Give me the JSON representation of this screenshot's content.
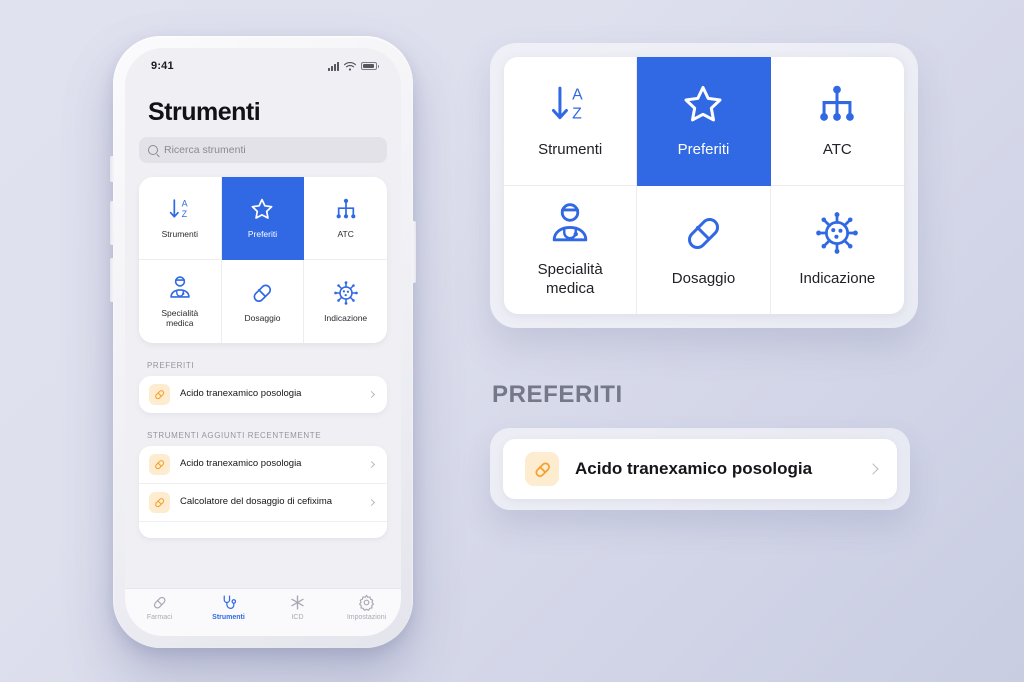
{
  "background": {
    "from": "#e0e2f0",
    "to": "#c9cde2"
  },
  "accent": {
    "blue": "#3069e3",
    "orange": "#f5a02a",
    "orange_bg": "#fdeccf",
    "label_gray": "#757888"
  },
  "phone": {
    "status": {
      "time": "9:41",
      "signal_icon": "cellular-signal-icon",
      "wifi_icon": "wifi-icon",
      "battery_icon": "battery-icon"
    },
    "title": "Strumenti",
    "search": {
      "placeholder": "Ricerca strumenti",
      "value": "",
      "icon": "search-icon"
    },
    "grid": [
      {
        "label": "Strumenti",
        "icon": "sort-alpha-down-icon",
        "selected": false
      },
      {
        "label": "Preferiti",
        "icon": "star-icon",
        "selected": true
      },
      {
        "label": "ATC",
        "icon": "hierarchy-tree-icon",
        "selected": false
      },
      {
        "label": "Specialità\nmedica",
        "icon": "doctor-icon",
        "selected": false
      },
      {
        "label": "Dosaggio",
        "icon": "pill-capsule-icon",
        "selected": false
      },
      {
        "label": "Indicazione",
        "icon": "virus-icon",
        "selected": false
      }
    ],
    "sections": [
      {
        "heading": "PREFERITI",
        "items": [
          {
            "label": "Acido tranexamico posologia",
            "icon": "pill-capsule-icon",
            "chevron": "chevron-right-icon"
          }
        ]
      },
      {
        "heading": "STRUMENTI AGGIUNTI RECENTEMENTE",
        "items": [
          {
            "label": "Acido tranexamico posologia",
            "icon": "pill-capsule-icon",
            "chevron": "chevron-right-icon"
          },
          {
            "label": "Calcolatore del dosaggio di cefixima",
            "icon": "pill-capsule-icon",
            "chevron": "chevron-right-icon"
          },
          {
            "label": "",
            "icon": "pill-capsule-icon",
            "chevron": "chevron-right-icon"
          }
        ]
      }
    ],
    "tabbar": [
      {
        "label": "Farmaci",
        "icon": "pill-capsule-icon",
        "active": false
      },
      {
        "label": "Strumenti",
        "icon": "stethoscope-icon",
        "active": true
      },
      {
        "label": "ICD",
        "icon": "asterisk-icon",
        "active": false
      },
      {
        "label": "Impostazioni",
        "icon": "gear-icon",
        "active": false
      }
    ]
  },
  "detail": {
    "grid": [
      {
        "label": "Strumenti",
        "icon": "sort-alpha-down-icon",
        "selected": false
      },
      {
        "label": "Preferiti",
        "icon": "star-icon",
        "selected": true
      },
      {
        "label": "ATC",
        "icon": "hierarchy-tree-icon",
        "selected": false
      },
      {
        "label": "Specialità medica",
        "icon": "doctor-icon",
        "selected": false
      },
      {
        "label": "Dosaggio",
        "icon": "pill-capsule-icon",
        "selected": false
      },
      {
        "label": "Indicazione",
        "icon": "virus-icon",
        "selected": false
      }
    ],
    "favorites_heading": "PREFERITI",
    "favorite_item": {
      "label": "Acido tranexamico posologia",
      "icon": "pill-capsule-icon",
      "chevron": "chevron-right-icon"
    }
  }
}
